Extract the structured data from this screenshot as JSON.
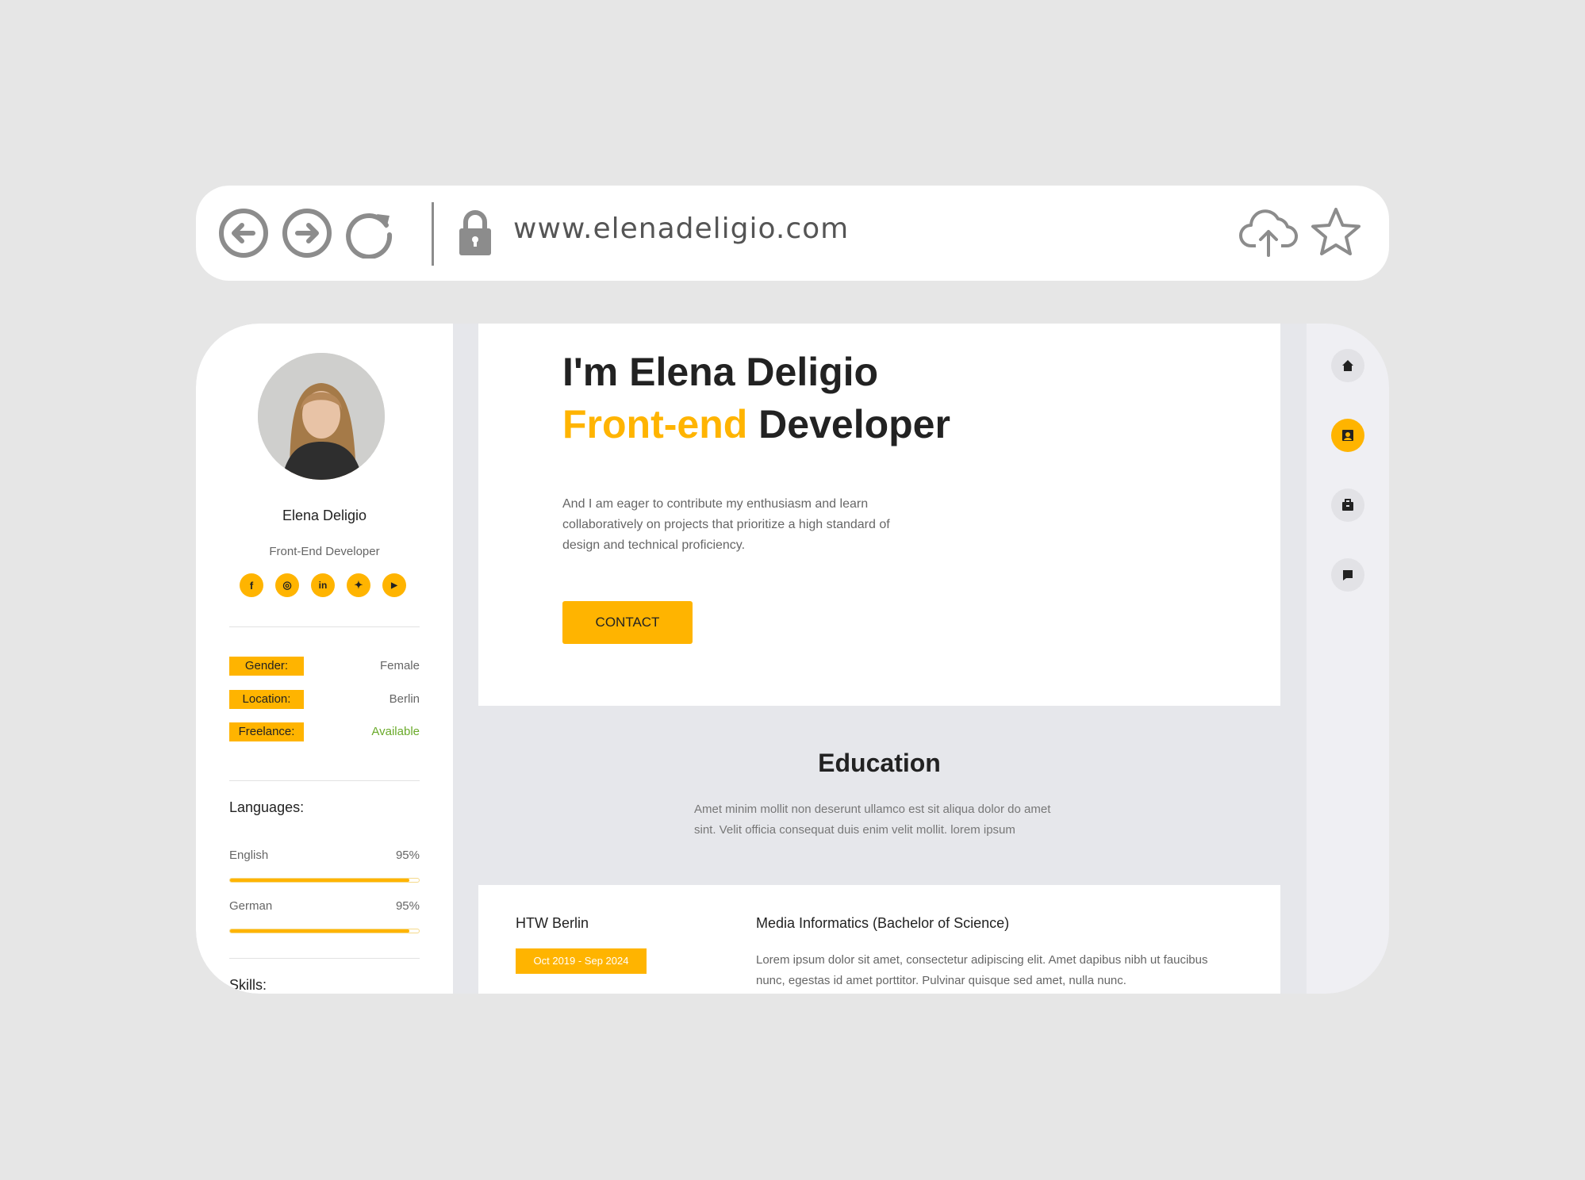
{
  "browser": {
    "url": "www.elenadeligio.com",
    "icons": [
      "back-arrow-icon",
      "forward-arrow-icon",
      "refresh-icon",
      "lock-icon",
      "cloud-upload-icon",
      "star-icon"
    ]
  },
  "profile": {
    "name": "Elena Deligio",
    "role": "Front-End Developer",
    "socials": [
      {
        "icon": "facebook-icon",
        "glyph": "f"
      },
      {
        "icon": "instagram-icon",
        "glyph": "◎"
      },
      {
        "icon": "linkedin-icon",
        "glyph": "in"
      },
      {
        "icon": "twitter-icon",
        "glyph": "✦"
      },
      {
        "icon": "youtube-icon",
        "glyph": "▶"
      }
    ],
    "info": [
      {
        "label": "Gender:",
        "value": "Female"
      },
      {
        "label": "Location:",
        "value": "Berlin"
      },
      {
        "label": "Freelance:",
        "value": "Available"
      }
    ],
    "languages_title": "Languages:",
    "languages": [
      {
        "name": "English",
        "percent": "95%",
        "level": 95
      },
      {
        "name": "German",
        "percent": "95%",
        "level": 95
      }
    ],
    "skills_title": "Skills:"
  },
  "hero": {
    "line1": "I'm Elena Deligio",
    "accent": "Front-end",
    "line2_rest": " Developer",
    "description": "And I am eager to contribute my enthusiasm and learn collaboratively on projects that prioritize a high standard of design and technical proficiency.",
    "contact_label": "CONTACT"
  },
  "education": {
    "title": "Education",
    "description": "Amet minim mollit non deserunt ullamco est sit aliqua dolor do amet sint. Velit officia consequat duis enim velit mollit. lorem ipsum",
    "items": [
      {
        "school": "HTW Berlin",
        "dates": "Oct 2019 - Sep 2024",
        "degree": "Media Informatics (Bachelor of Science)",
        "text": "Lorem ipsum dolor sit amet, consectetur adipiscing elit. Amet dapibus nibh ut faucibus nunc, egestas id amet porttitor. Pulvinar quisque sed amet, nulla nunc."
      }
    ]
  },
  "right_nav": {
    "items": [
      "home-icon",
      "education-icon",
      "briefcase-icon",
      "chat-icon"
    ],
    "active": "education-icon"
  },
  "colors": {
    "accent": "#ffb400",
    "available": "#6aaa2a"
  }
}
